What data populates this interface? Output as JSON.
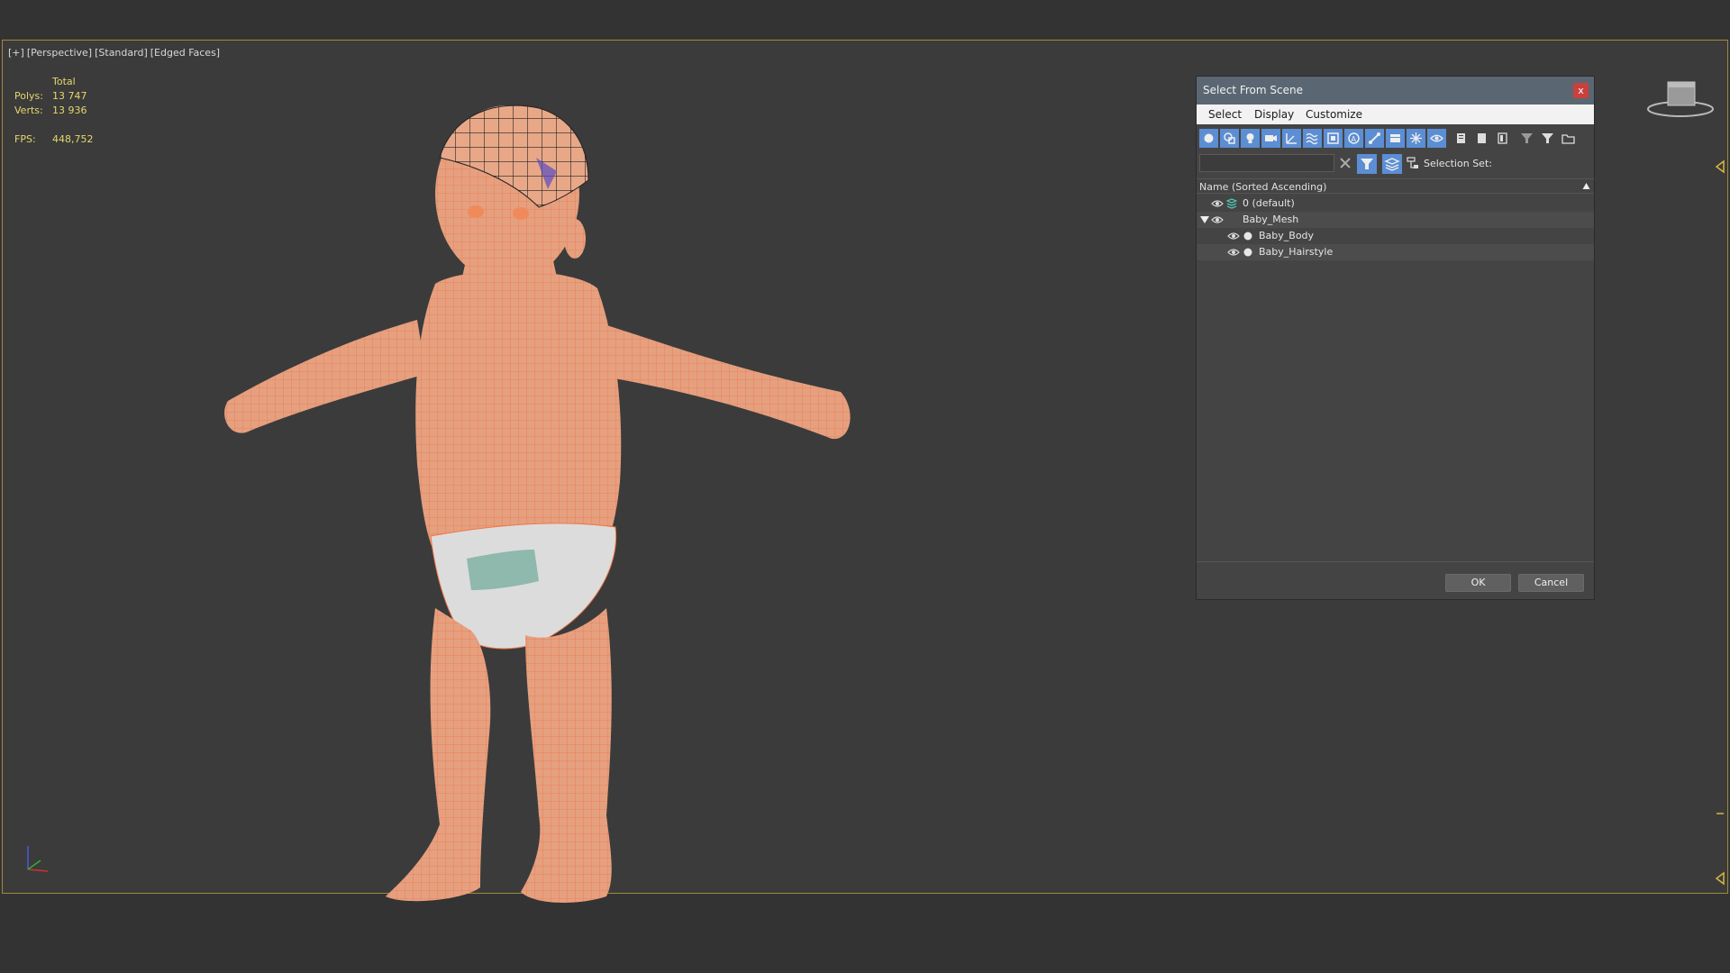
{
  "viewport": {
    "labels": [
      "[+]",
      "[Perspective]",
      "[Standard]",
      "[Edged Faces]"
    ],
    "stats": {
      "header": "Total",
      "polys_label": "Polys:",
      "polys_value": "13 747",
      "verts_label": "Verts:",
      "verts_value": "13 936",
      "fps_label": "FPS:",
      "fps_value": "448,752"
    },
    "model_color": "#f08050"
  },
  "dialog": {
    "title": "Select From Scene",
    "close_glyph": "x",
    "menu": [
      "Select",
      "Display",
      "Customize"
    ],
    "search": {
      "value": "",
      "placeholder": ""
    },
    "selection_set_label": "Selection Set:",
    "column_header": "Name (Sorted Ascending)",
    "tree": [
      {
        "name": "0 (default)",
        "icon": "layer-icon",
        "level": 0,
        "expandable": false
      },
      {
        "name": "Baby_Mesh",
        "icon": "none",
        "level": 0,
        "expandable": true,
        "expanded": true
      },
      {
        "name": "Baby_Body",
        "icon": "object-dot-icon",
        "level": 1,
        "expandable": false
      },
      {
        "name": "Baby_Hairstyle",
        "icon": "object-dot-icon",
        "level": 1,
        "expandable": false
      }
    ],
    "ok_label": "OK",
    "cancel_label": "Cancel",
    "accent": "#5b8ed4",
    "title_bar_color": "#5a6773"
  }
}
